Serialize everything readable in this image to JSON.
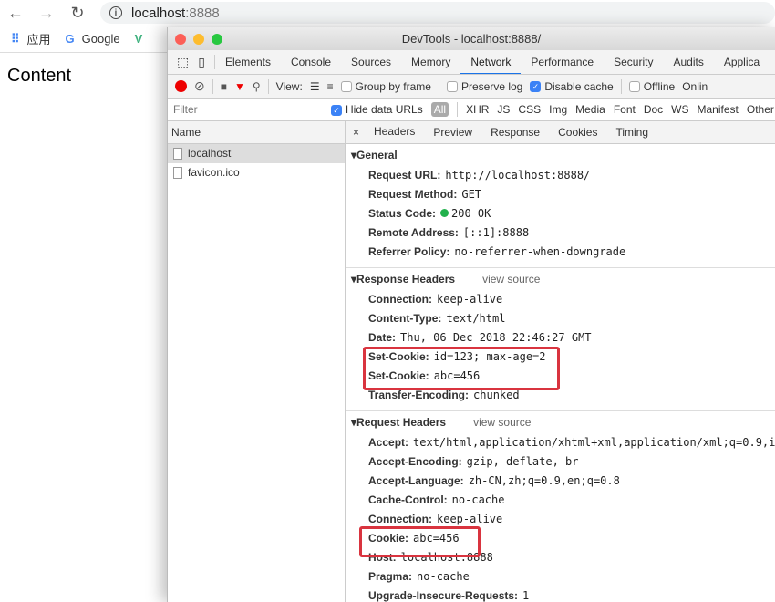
{
  "browser": {
    "url_host": "localhost",
    "url_port": ":8888",
    "bookmarks": [
      "应用",
      "Google"
    ],
    "page_content": "Content"
  },
  "devtools": {
    "title": "DevTools - localhost:8888/",
    "colors": {
      "close": "#fc5f57",
      "minimize": "#fdbc2e",
      "zoom": "#28c840",
      "highlight": "#d9343f",
      "accent": "#1a73e8"
    },
    "tabs": [
      "Elements",
      "Console",
      "Sources",
      "Memory",
      "Network",
      "Performance",
      "Security",
      "Audits",
      "Applica"
    ],
    "active_tab": "Network",
    "toolbar": {
      "view_label": "View:",
      "group_by_frame": "Group by frame",
      "preserve_log": "Preserve log",
      "disable_cache": "Disable cache",
      "offline": "Offline",
      "online": "Onlin"
    },
    "filter": {
      "placeholder": "Filter",
      "hide_data_urls": "Hide data URLs",
      "types": [
        "All",
        "XHR",
        "JS",
        "CSS",
        "Img",
        "Media",
        "Font",
        "Doc",
        "WS",
        "Manifest",
        "Other"
      ]
    },
    "requests": {
      "header": "Name",
      "items": [
        "localhost",
        "favicon.ico"
      ]
    },
    "subtabs": [
      "Headers",
      "Preview",
      "Response",
      "Cookies",
      "Timing"
    ],
    "general": {
      "title": "General",
      "rows": [
        [
          "Request URL:",
          "http://localhost:8888/"
        ],
        [
          "Request Method:",
          "GET"
        ],
        [
          "Status Code:",
          "200 OK"
        ],
        [
          "Remote Address:",
          "[::1]:8888"
        ],
        [
          "Referrer Policy:",
          "no-referrer-when-downgrade"
        ]
      ]
    },
    "response": {
      "title": "Response Headers",
      "view_source": "view source",
      "rows": [
        [
          "Connection:",
          "keep-alive"
        ],
        [
          "Content-Type:",
          "text/html"
        ],
        [
          "Date:",
          "Thu, 06 Dec 2018 22:46:27 GMT"
        ],
        [
          "Set-Cookie:",
          "id=123; max-age=2"
        ],
        [
          "Set-Cookie:",
          "abc=456"
        ],
        [
          "Transfer-Encoding:",
          "chunked"
        ]
      ]
    },
    "request": {
      "title": "Request Headers",
      "view_source": "view source",
      "rows": [
        [
          "Accept:",
          "text/html,application/xhtml+xml,application/xml;q=0.9,i"
        ],
        [
          "Accept-Encoding:",
          "gzip, deflate, br"
        ],
        [
          "Accept-Language:",
          "zh-CN,zh;q=0.9,en;q=0.8"
        ],
        [
          "Cache-Control:",
          "no-cache"
        ],
        [
          "Connection:",
          "keep-alive"
        ],
        [
          "Cookie:",
          "abc=456"
        ],
        [
          "Host:",
          "localhost:8888"
        ],
        [
          "Pragma:",
          "no-cache"
        ],
        [
          "Upgrade-Insecure-Requests:",
          "1"
        ]
      ]
    }
  }
}
